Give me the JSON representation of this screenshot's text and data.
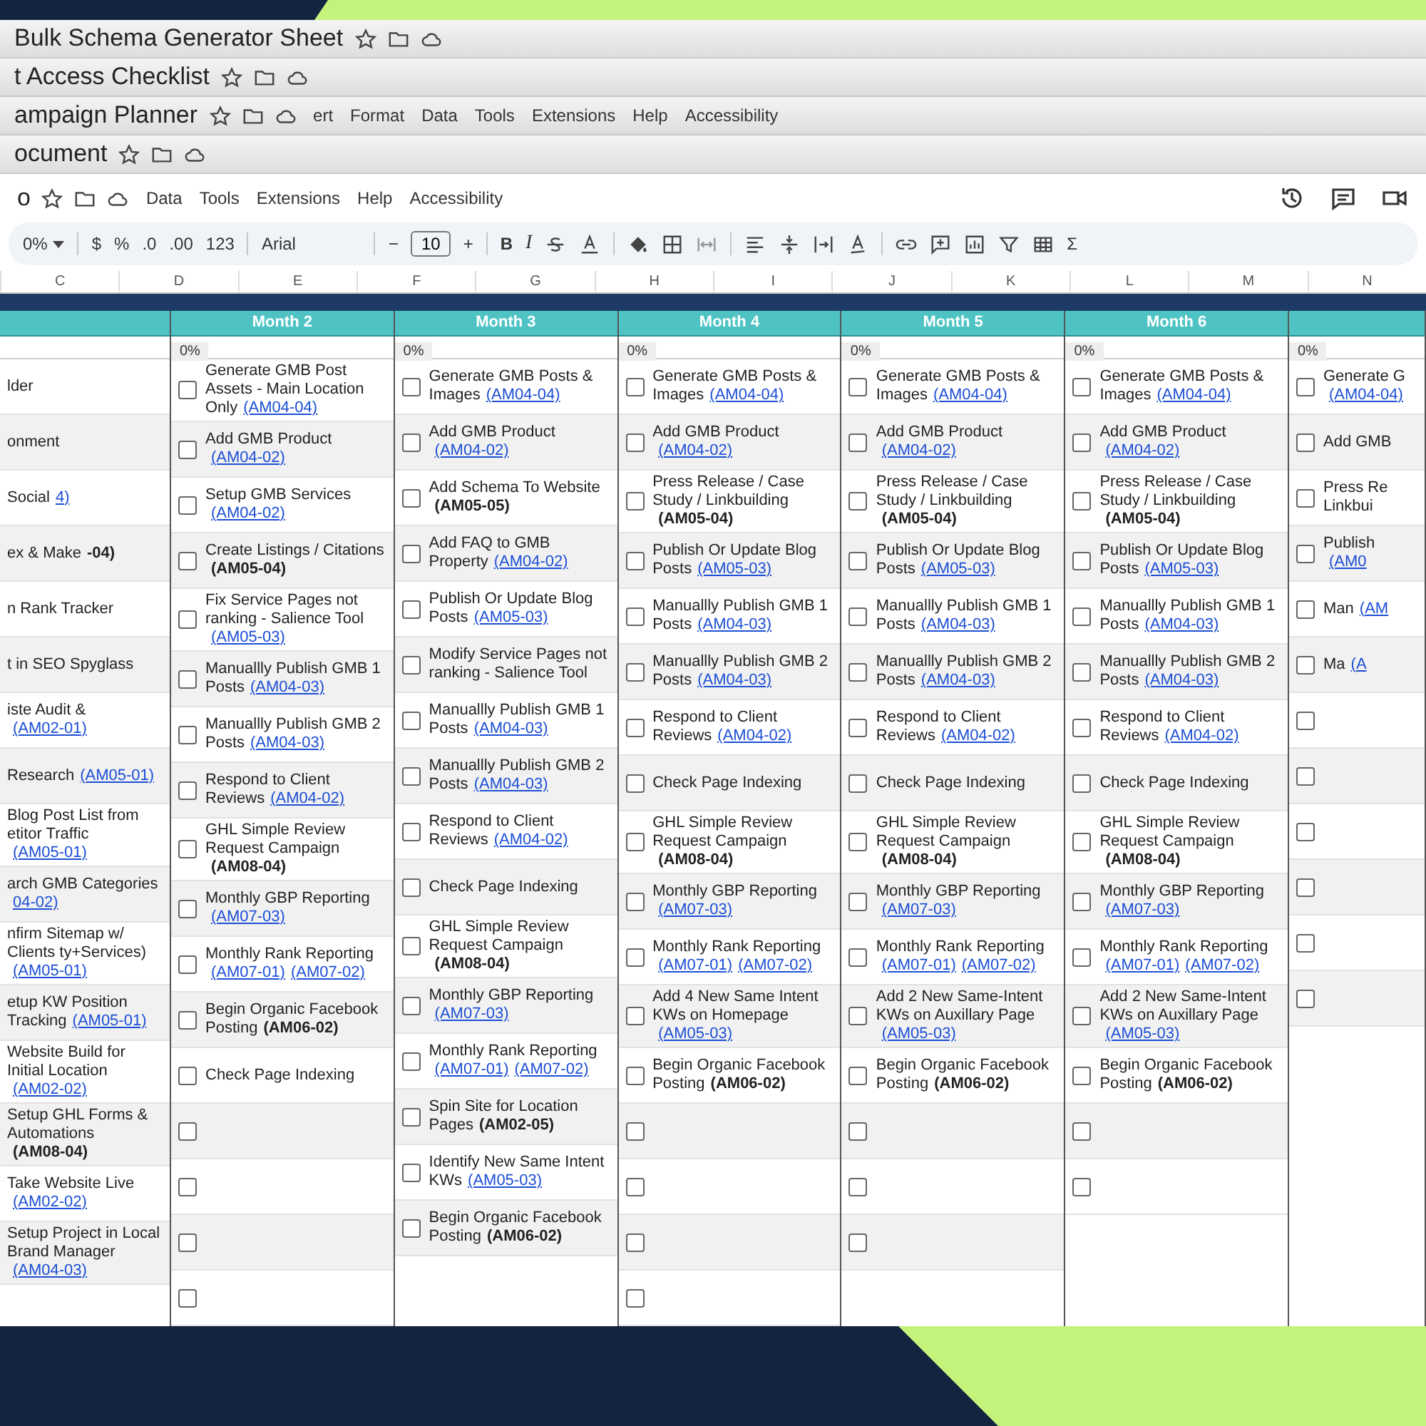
{
  "windows": [
    {
      "title": "Bulk Schema Generator Sheet"
    },
    {
      "title": "t Access Checklist"
    },
    {
      "title": "ampaign Planner",
      "menu": [
        "ert",
        "Format",
        "Data",
        "Tools",
        "Extensions",
        "Help",
        "Accessibility"
      ]
    },
    {
      "title": "ocument"
    }
  ],
  "main": {
    "title": "o",
    "menu": [
      "Data",
      "Tools",
      "Extensions",
      "Help",
      "Accessibility"
    ]
  },
  "toolbar": {
    "zoom": "0%",
    "currency": "$",
    "percent": "%",
    "decrease_decimals": ".0",
    "increase_decimals": ".00",
    "number_format": "123",
    "font": "Arial",
    "minus": "−",
    "font_size": "10",
    "plus": "+",
    "bold": "B",
    "italic": "I",
    "sum": "Σ"
  },
  "column_letters": [
    "C",
    "D",
    "E",
    "F",
    "G",
    "H",
    "I",
    "J",
    "K",
    "L",
    "M",
    "N"
  ],
  "months": [
    {
      "rows": [
        {
          "text": "lder"
        },
        {
          "text": "onment"
        },
        {
          "text": "Social",
          "codes": [
            "4)"
          ],
          "code_bold": false
        },
        {
          "text": "ex & Make",
          "codes": [
            "-04)"
          ],
          "code_bold": true
        },
        {
          "text": "n Rank Tracker"
        },
        {
          "text": "t in SEO Spyglass"
        },
        {
          "text": "iste Audit &",
          "codes": [
            "(AM02-01)"
          ],
          "code_bold": false
        },
        {
          "text": "Research",
          "codes": [
            "(AM05-01)"
          ],
          "code_bold": false
        },
        {
          "text": "Blog Post List from etitor Traffic",
          "codes": [
            "(AM05-01)"
          ],
          "code_bold": false
        },
        {
          "text": "arch GMB Categories",
          "codes": [
            "04-02)"
          ],
          "code_bold": false
        },
        {
          "text": "nfirm Sitemap w/ Clients ty+Services)",
          "codes": [
            "(AM05-01)"
          ],
          "code_bold": false
        },
        {
          "text": "etup KW Position Tracking",
          "codes": [
            "(AM05-01)"
          ],
          "code_bold": false
        },
        {
          "text": "Website Build for Initial Location",
          "codes": [
            "(AM02-02)"
          ],
          "code_bold": false
        },
        {
          "text": "Setup GHL Forms & Automations",
          "codes": [
            "(AM08-04)"
          ],
          "code_bold": true
        },
        {
          "text": "Take Website Live",
          "codes": [
            "(AM02-02)"
          ],
          "code_bold": false
        },
        {
          "text": "Setup Project in Local Brand Manager",
          "codes": [
            "(AM04-03)"
          ],
          "code_bold": false
        }
      ]
    },
    {
      "header": "Month 2",
      "percent": "0%",
      "rows": [
        {
          "text": "Generate GMB Post Assets - Main Location Only",
          "codes": [
            "(AM04-04)"
          ],
          "code_bold": false,
          "checked": false
        },
        {
          "text": "Add GMB Product",
          "codes": [
            "(AM04-02)"
          ],
          "code_bold": false,
          "checked": false
        },
        {
          "text": "Setup GMB Services",
          "codes": [
            "(AM04-02)"
          ],
          "code_bold": false,
          "checked": false
        },
        {
          "text": "Create Listings / Citations",
          "codes": [
            "(AM05-04)"
          ],
          "code_bold": true,
          "checked": false
        },
        {
          "text": "Fix Service Pages not ranking - Salience Tool",
          "codes": [
            "(AM05-03)"
          ],
          "code_bold": false,
          "checked": false
        },
        {
          "text": "Manuallly Publish GMB 1 Posts",
          "codes": [
            "(AM04-03)"
          ],
          "code_bold": false,
          "checked": false
        },
        {
          "text": "Manuallly Publish GMB 2 Posts",
          "codes": [
            "(AM04-03)"
          ],
          "code_bold": false,
          "checked": false
        },
        {
          "text": "Respond to Client Reviews",
          "codes": [
            "(AM04-02)"
          ],
          "code_bold": false,
          "checked": false
        },
        {
          "text": "GHL Simple Review Request Campaign",
          "codes": [
            "(AM08-04)"
          ],
          "code_bold": true,
          "checked": false
        },
        {
          "text": "Monthly GBP Reporting",
          "codes": [
            "(AM07-03)"
          ],
          "code_bold": false,
          "checked": false
        },
        {
          "text": "Monthly Rank Reporting",
          "codes": [
            "(AM07-01)",
            "(AM07-02)"
          ],
          "code_bold": false,
          "checked": false
        },
        {
          "text": "Begin Organic Facebook Posting",
          "codes": [
            "(AM06-02)"
          ],
          "code_bold": true,
          "checked": false
        },
        {
          "text": "Check Page Indexing",
          "checked": false
        },
        {
          "checked": false
        },
        {
          "checked": false
        },
        {
          "checked": false
        },
        {
          "checked": false
        }
      ]
    },
    {
      "header": "Month 3",
      "percent": "0%",
      "rows": [
        {
          "text": "Generate GMB Posts & Images",
          "codes": [
            "(AM04-04)"
          ],
          "code_bold": false,
          "checked": false
        },
        {
          "text": "Add GMB Product",
          "codes": [
            "(AM04-02)"
          ],
          "code_bold": false,
          "checked": false
        },
        {
          "text": "Add Schema To Website",
          "codes": [
            "(AM05-05)"
          ],
          "code_bold": true,
          "checked": false
        },
        {
          "text": "Add FAQ to GMB Property",
          "codes": [
            "(AM04-02)"
          ],
          "code_bold": false,
          "checked": false
        },
        {
          "text": "Publish Or Update Blog Posts",
          "codes": [
            "(AM05-03)"
          ],
          "code_bold": false,
          "checked": false
        },
        {
          "text": "Modify Service Pages not ranking - Salience Tool",
          "checked": false
        },
        {
          "text": "Manuallly Publish GMB 1 Posts",
          "codes": [
            "(AM04-03)"
          ],
          "code_bold": false,
          "checked": false
        },
        {
          "text": "Manuallly Publish GMB 2 Posts",
          "codes": [
            "(AM04-03)"
          ],
          "code_bold": false,
          "checked": false
        },
        {
          "text": "Respond to Client Reviews",
          "codes": [
            "(AM04-02)"
          ],
          "code_bold": false,
          "checked": false
        },
        {
          "text": "Check Page Indexing",
          "checked": false
        },
        {
          "text": "GHL Simple Review Request Campaign",
          "codes": [
            "(AM08-04)"
          ],
          "code_bold": true,
          "checked": false
        },
        {
          "text": "Monthly GBP Reporting",
          "codes": [
            "(AM07-03)"
          ],
          "code_bold": false,
          "checked": false
        },
        {
          "text": "Monthly Rank Reporting",
          "codes": [
            "(AM07-01)",
            "(AM07-02)"
          ],
          "code_bold": false,
          "checked": false
        },
        {
          "text": "Spin Site for Location Pages",
          "codes": [
            "(AM02-05)"
          ],
          "code_bold": true,
          "checked": false
        },
        {
          "text": "Identify New Same Intent KWs",
          "codes": [
            "(AM05-03)"
          ],
          "code_bold": false,
          "checked": false
        },
        {
          "text": "Begin Organic Facebook Posting",
          "codes": [
            "(AM06-02)"
          ],
          "code_bold": true,
          "checked": false
        }
      ]
    },
    {
      "header": "Month 4",
      "percent": "0%",
      "rows": [
        {
          "text": "Generate GMB Posts & Images",
          "codes": [
            "(AM04-04)"
          ],
          "code_bold": false,
          "checked": false
        },
        {
          "text": "Add GMB Product",
          "codes": [
            "(AM04-02)"
          ],
          "code_bold": false,
          "checked": false
        },
        {
          "text": "Press Release / Case Study / Linkbuilding",
          "codes": [
            "(AM05-04)"
          ],
          "code_bold": true,
          "checked": false
        },
        {
          "text": "Publish Or Update Blog Posts",
          "codes": [
            "(AM05-03)"
          ],
          "code_bold": false,
          "checked": false
        },
        {
          "text": "Manuallly Publish GMB 1 Posts",
          "codes": [
            "(AM04-03)"
          ],
          "code_bold": false,
          "checked": false
        },
        {
          "text": "Manuallly Publish GMB 2 Posts",
          "codes": [
            "(AM04-03)"
          ],
          "code_bold": false,
          "checked": false
        },
        {
          "text": "Respond to Client Reviews",
          "codes": [
            "(AM04-02)"
          ],
          "code_bold": false,
          "checked": false
        },
        {
          "text": "Check Page Indexing",
          "checked": false
        },
        {
          "text": "GHL Simple Review Request Campaign",
          "codes": [
            "(AM08-04)"
          ],
          "code_bold": true,
          "checked": false
        },
        {
          "text": "Monthly GBP Reporting",
          "codes": [
            "(AM07-03)"
          ],
          "code_bold": false,
          "checked": false
        },
        {
          "text": "Monthly Rank Reporting",
          "codes": [
            "(AM07-01)",
            "(AM07-02)"
          ],
          "code_bold": false,
          "checked": false
        },
        {
          "text": "Add 4 New Same Intent KWs on Homepage",
          "codes": [
            "(AM05-03)"
          ],
          "code_bold": false,
          "checked": false
        },
        {
          "text": "Begin Organic Facebook Posting",
          "codes": [
            "(AM06-02)"
          ],
          "code_bold": true,
          "checked": false
        },
        {
          "checked": false
        },
        {
          "checked": false
        },
        {
          "checked": false
        },
        {
          "checked": false
        }
      ]
    },
    {
      "header": "Month 5",
      "percent": "0%",
      "rows": [
        {
          "text": "Generate GMB Posts & Images",
          "codes": [
            "(AM04-04)"
          ],
          "code_bold": false,
          "checked": false
        },
        {
          "text": "Add GMB Product",
          "codes": [
            "(AM04-02)"
          ],
          "code_bold": false,
          "checked": false
        },
        {
          "text": "Press Release / Case Study / Linkbuilding",
          "codes": [
            "(AM05-04)"
          ],
          "code_bold": true,
          "checked": false
        },
        {
          "text": "Publish Or Update Blog Posts",
          "codes": [
            "(AM05-03)"
          ],
          "code_bold": false,
          "checked": false
        },
        {
          "text": "Manuallly Publish GMB 1 Posts",
          "codes": [
            "(AM04-03)"
          ],
          "code_bold": false,
          "checked": false
        },
        {
          "text": "Manuallly Publish GMB 2 Posts",
          "codes": [
            "(AM04-03)"
          ],
          "code_bold": false,
          "checked": false
        },
        {
          "text": "Respond to Client Reviews",
          "codes": [
            "(AM04-02)"
          ],
          "code_bold": false,
          "checked": false
        },
        {
          "text": "Check Page Indexing",
          "checked": false
        },
        {
          "text": "GHL Simple Review Request Campaign",
          "codes": [
            "(AM08-04)"
          ],
          "code_bold": true,
          "checked": false
        },
        {
          "text": "Monthly GBP Reporting",
          "codes": [
            "(AM07-03)"
          ],
          "code_bold": false,
          "checked": false
        },
        {
          "text": "Monthly Rank Reporting",
          "codes": [
            "(AM07-01)",
            "(AM07-02)"
          ],
          "code_bold": false,
          "checked": false
        },
        {
          "text": "Add 2 New Same-Intent KWs on Auxillary Page",
          "codes": [
            "(AM05-03)"
          ],
          "code_bold": false,
          "checked": false
        },
        {
          "text": "Begin Organic Facebook Posting",
          "codes": [
            "(AM06-02)"
          ],
          "code_bold": true,
          "checked": false
        },
        {
          "checked": false
        },
        {
          "checked": false
        },
        {
          "checked": false
        }
      ]
    },
    {
      "header": "Month 6",
      "percent": "0%",
      "rows": [
        {
          "text": "Generate GMB Posts & Images",
          "codes": [
            "(AM04-04)"
          ],
          "code_bold": false,
          "checked": false
        },
        {
          "text": "Add GMB Product",
          "codes": [
            "(AM04-02)"
          ],
          "code_bold": false,
          "checked": false
        },
        {
          "text": "Press Release / Case Study / Linkbuilding",
          "codes": [
            "(AM05-04)"
          ],
          "code_bold": true,
          "checked": false
        },
        {
          "text": "Publish Or Update Blog Posts",
          "codes": [
            "(AM05-03)"
          ],
          "code_bold": false,
          "checked": false
        },
        {
          "text": "Manuallly Publish GMB 1 Posts",
          "codes": [
            "(AM04-03)"
          ],
          "code_bold": false,
          "checked": false
        },
        {
          "text": "Manuallly Publish GMB 2 Posts",
          "codes": [
            "(AM04-03)"
          ],
          "code_bold": false,
          "checked": false
        },
        {
          "text": "Respond to Client Reviews",
          "codes": [
            "(AM04-02)"
          ],
          "code_bold": false,
          "checked": false
        },
        {
          "text": "Check Page Indexing",
          "checked": false
        },
        {
          "text": "GHL Simple Review Request Campaign",
          "codes": [
            "(AM08-04)"
          ],
          "code_bold": true,
          "checked": false
        },
        {
          "text": "Monthly GBP Reporting",
          "codes": [
            "(AM07-03)"
          ],
          "code_bold": false,
          "checked": false
        },
        {
          "text": "Monthly Rank Reporting",
          "codes": [
            "(AM07-01)",
            "(AM07-02)"
          ],
          "code_bold": false,
          "checked": false
        },
        {
          "text": "Add 2 New Same-Intent KWs on Auxillary Page",
          "codes": [
            "(AM05-03)"
          ],
          "code_bold": false,
          "checked": false
        },
        {
          "text": "Begin Organic Facebook Posting",
          "codes": [
            "(AM06-02)"
          ],
          "code_bold": true,
          "checked": false
        },
        {
          "checked": false
        },
        {
          "checked": false
        }
      ]
    },
    {
      "percent": "0%",
      "rows": [
        {
          "text": "Generate G",
          "codes": [
            "(AM04-04)"
          ],
          "code_bold": false,
          "checked": false
        },
        {
          "text": "Add GMB",
          "checked": false
        },
        {
          "text": "Press Re Linkbui",
          "checked": false
        },
        {
          "text": "Publish",
          "codes": [
            "(AM0"
          ],
          "code_bold": false,
          "checked": false
        },
        {
          "text": "Man",
          "codes": [
            "(AM"
          ],
          "code_bold": false,
          "checked": false
        },
        {
          "text": "Ma",
          "codes": [
            "(A"
          ],
          "code_bold": false,
          "checked": false
        },
        {
          "checked": false
        },
        {
          "checked": false
        },
        {
          "checked": false
        },
        {
          "checked": false
        },
        {
          "checked": false
        },
        {
          "checked": false
        }
      ]
    }
  ]
}
